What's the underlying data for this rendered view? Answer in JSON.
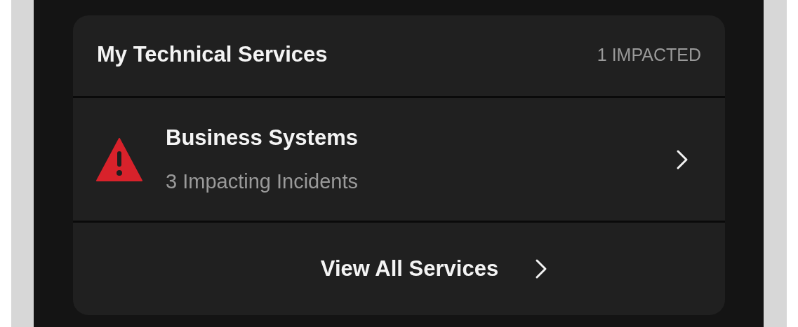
{
  "card": {
    "title": "My Technical Services",
    "badge": "1 IMPACTED",
    "services": [
      {
        "name": "Business Systems",
        "subtitle": "3 Impacting Incidents",
        "impacted": true
      }
    ],
    "footer_link": "View All Services"
  }
}
